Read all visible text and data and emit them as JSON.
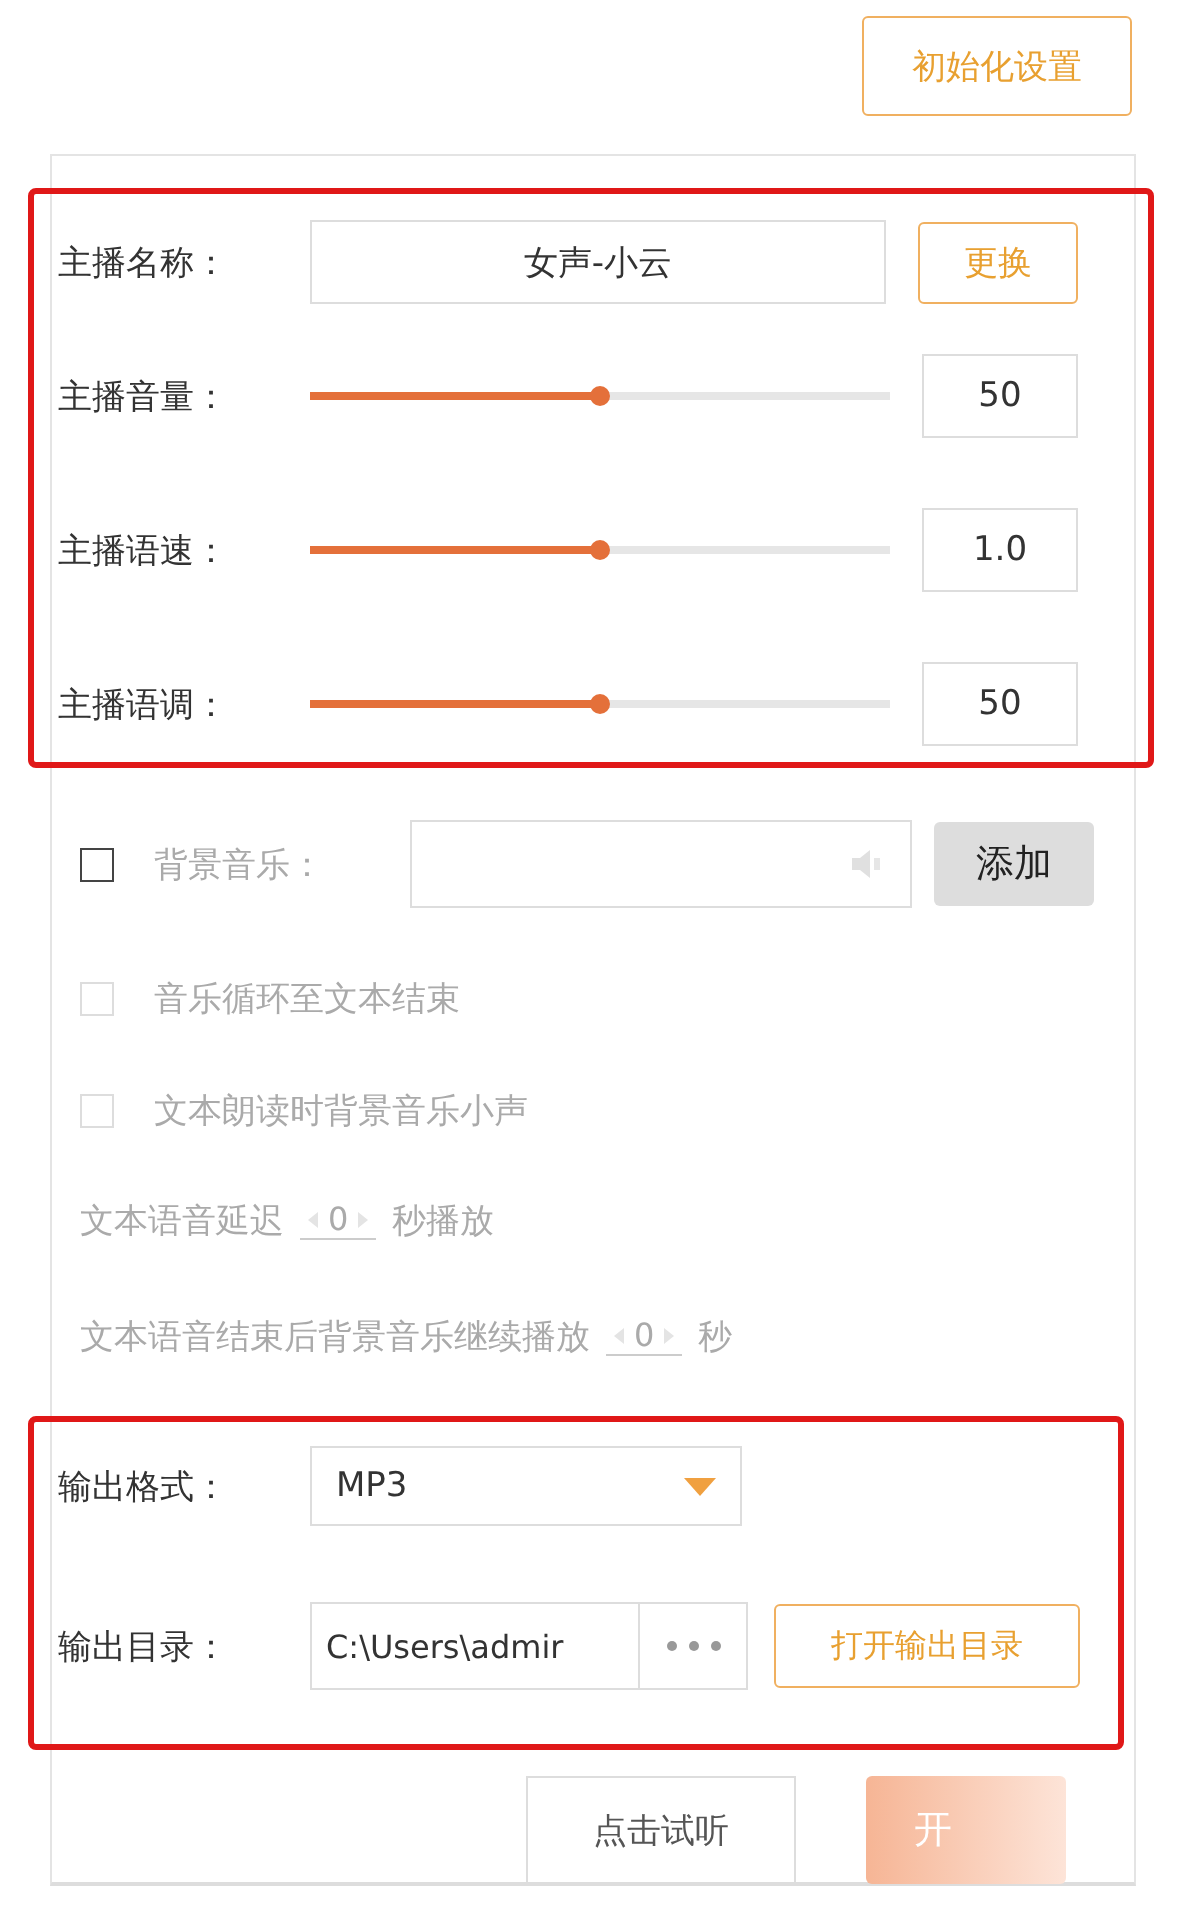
{
  "reset_button": "初始化设置",
  "anchor": {
    "label": "主播名称：",
    "value": "女声-小云",
    "change_button": "更换"
  },
  "sliders": [
    {
      "label": "主播音量：",
      "level": 0.5,
      "value": "50"
    },
    {
      "label": "主播语速：",
      "level": 0.5,
      "value": "1.0"
    },
    {
      "label": "主播语调：",
      "level": 0.5,
      "value": "50"
    }
  ],
  "background_music": {
    "label": "背景音乐：",
    "checked": false,
    "disabled": true,
    "add_button": "添加"
  },
  "options": [
    {
      "label": "音乐循环至文本结束",
      "checked": false,
      "disabled": true
    },
    {
      "label": "文本朗读时背景音乐小声",
      "checked": false,
      "disabled": true
    }
  ],
  "delays": [
    {
      "before": "文本语音延迟",
      "value": "0",
      "after": "秒播放"
    },
    {
      "before": "文本语音结束后背景音乐继续播放",
      "value": "0",
      "after": "秒"
    }
  ],
  "output": {
    "format_label": "输出格式：",
    "format": "MP3",
    "dir_label": "输出目录：",
    "dir": "C:\\Users\\admir",
    "open_button": "打开输出目录"
  },
  "preview_button": "点击试听",
  "start_button": "开"
}
